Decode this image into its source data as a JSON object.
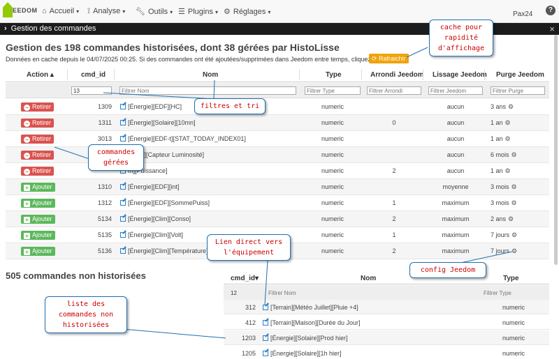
{
  "nav": {
    "logo_text": "EEDOM",
    "items": [
      {
        "label": "Accueil",
        "icon": "home-icon"
      },
      {
        "label": "Analyse",
        "icon": "analyse-icon"
      },
      {
        "label": "Outils",
        "icon": "wrench-icon"
      },
      {
        "label": "Plugins",
        "icon": "list-icon"
      },
      {
        "label": "Réglages",
        "icon": "gear-icon"
      }
    ],
    "user": "Pax24",
    "help": "?"
  },
  "modal": {
    "title": "Gestion des commandes",
    "close": "×"
  },
  "main": {
    "title": "Gestion des 198 commandes historisées, dont 38 gérées par HistoLisse",
    "cache_text": "Données en cache depuis le 04/07/2025 00:25. Si des commandes ont été ajoutées/supprimées dans Jeedom entre temps, cliquez ici :",
    "refresh_label": "Rafraichir"
  },
  "table": {
    "headers": {
      "action": "Action",
      "cmd_id": "cmd_id",
      "nom": "Nom",
      "type": "Type",
      "arrondi": "Arrondi Jeedom",
      "lissage": "Lissage Jeedom",
      "purge": "Purge Jeedom"
    },
    "filters": {
      "cmd_id_value": "13",
      "nom_placeholder": "Filtrer Nom",
      "type_placeholder": "Filtrer Type",
      "arrondi_placeholder": "Filtrer Arrondi",
      "lissage_placeholder": "Filtrer Jeedom",
      "purge_placeholder": "Filtrer Purge"
    },
    "rows": [
      {
        "action": "Retirer",
        "kind": "remove",
        "id": "1309",
        "name": "[Énergie][EDF][HC]",
        "type": "numeric",
        "arrondi": "",
        "lissage": "aucun",
        "purge": "3 ans"
      },
      {
        "action": "Retirer",
        "kind": "remove",
        "id": "1311",
        "name": "[Énergie][Solaire][10mn]",
        "type": "numeric",
        "arrondi": "0",
        "lissage": "aucun",
        "purge": "1 an"
      },
      {
        "action": "Retirer",
        "kind": "remove",
        "id": "3013",
        "name": "[Énergie][EDF-t][STAT_TODAY_INDEX01]",
        "type": "numeric",
        "arrondi": "",
        "lissage": "aucun",
        "purge": "1 an"
      },
      {
        "action": "Retirer",
        "kind": "remove",
        "id": "",
        "name": "teway][Capteur Luminosité]",
        "type": "numeric",
        "arrondi": "",
        "lissage": "aucun",
        "purge": "6 mois"
      },
      {
        "action": "Retirer",
        "kind": "remove",
        "id": "",
        "name": "m][Puissance]",
        "type": "numeric",
        "arrondi": "2",
        "lissage": "aucun",
        "purge": "1 an"
      },
      {
        "action": "Ajouter",
        "kind": "add",
        "id": "1310",
        "name": "[Énergie][EDF][int]",
        "type": "numeric",
        "arrondi": "",
        "lissage": "moyenne",
        "purge": "3 mois"
      },
      {
        "action": "Ajouter",
        "kind": "add",
        "id": "1312",
        "name": "[Énergie][EDF][SommePuiss]",
        "type": "numeric",
        "arrondi": "1",
        "lissage": "maximum",
        "purge": "3 mois"
      },
      {
        "action": "Ajouter",
        "kind": "add",
        "id": "5134",
        "name": "[Énergie][Clim][Conso]",
        "type": "numeric",
        "arrondi": "2",
        "lissage": "maximum",
        "purge": "2 ans"
      },
      {
        "action": "Ajouter",
        "kind": "add",
        "id": "5135",
        "name": "[Énergie][Clim][Volt]",
        "type": "numeric",
        "arrondi": "1",
        "lissage": "maximum",
        "purge": "7 jours"
      },
      {
        "action": "Ajouter",
        "kind": "add",
        "id": "5136",
        "name": "[Énergie][Clim][Température]",
        "type": "numeric",
        "arrondi": "2",
        "lissage": "maximum",
        "purge": "7 jours"
      }
    ]
  },
  "nonhist": {
    "title": "505 commandes non historisées",
    "headers": {
      "cmd_id": "cmd_id",
      "nom": "Nom",
      "type": "Type"
    },
    "filters": {
      "cmd_id_value": "12",
      "nom_placeholder": "Filtrer Nom",
      "type_placeholder": "Filtrer Type"
    },
    "rows": [
      {
        "id": "312",
        "name": "[Terrain][Météo Juillet][Pluie +4]",
        "type": "numeric"
      },
      {
        "id": "412",
        "name": "[Terrain][Maison][Durée du Jour]",
        "type": "numeric"
      },
      {
        "id": "1203",
        "name": "[Énergie][Solaire][Prod hier]",
        "type": "numeric"
      },
      {
        "id": "1205",
        "name": "[Énergie][Solaire][1h hier]",
        "type": "numeric"
      }
    ]
  },
  "callouts": {
    "cache": "cache pour rapidité d'affichage",
    "filters": "filtres et tri",
    "managed": "commandes gérées",
    "link": "Lien direct vers l'équipement",
    "config": "config Jeedom",
    "nonhist": "liste des commandes non historisées"
  },
  "colors": {
    "remove": "#d9534f",
    "add": "#5cb85c",
    "refresh": "#f0a30a",
    "callout_border": "#1f6fb3",
    "callout_text": "#cc0000"
  }
}
